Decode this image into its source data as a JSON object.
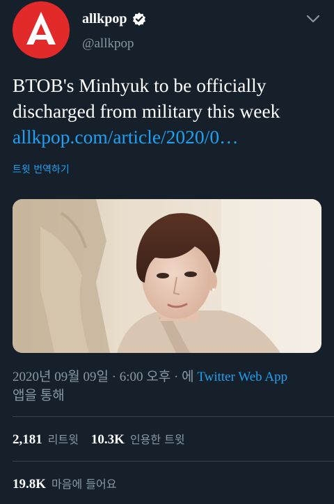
{
  "account": {
    "display_name": "allkpop",
    "handle": "@allkpop",
    "verified": true,
    "avatar_color": "#e22a2a"
  },
  "tweet": {
    "line1": "BTOB's Minhyuk to be officially",
    "line2": "discharged from military this week",
    "link_text": "allkpop.com/article/2020/0…",
    "translate_label": "트윗 번역하기"
  },
  "meta": {
    "timestamp": "2020년 09월 09일 · 6:00 오후 · 에 ",
    "app_name": "Twitter Web App",
    "app_suffix": "앱을 통해"
  },
  "stats": {
    "retweets_count": "2,181",
    "retweets_label": "리트윗",
    "quotes_count": "10.3K",
    "quotes_label": "인용한 트윗",
    "likes_count": "19.8K",
    "likes_label": "마음에 들어요"
  },
  "colors": {
    "background": "#15202b",
    "link": "#1da1f2",
    "secondary_text": "#8899a6",
    "divider": "#38444d"
  },
  "icons": {
    "verified": "verified-badge-icon",
    "more": "chevron-down-icon"
  }
}
